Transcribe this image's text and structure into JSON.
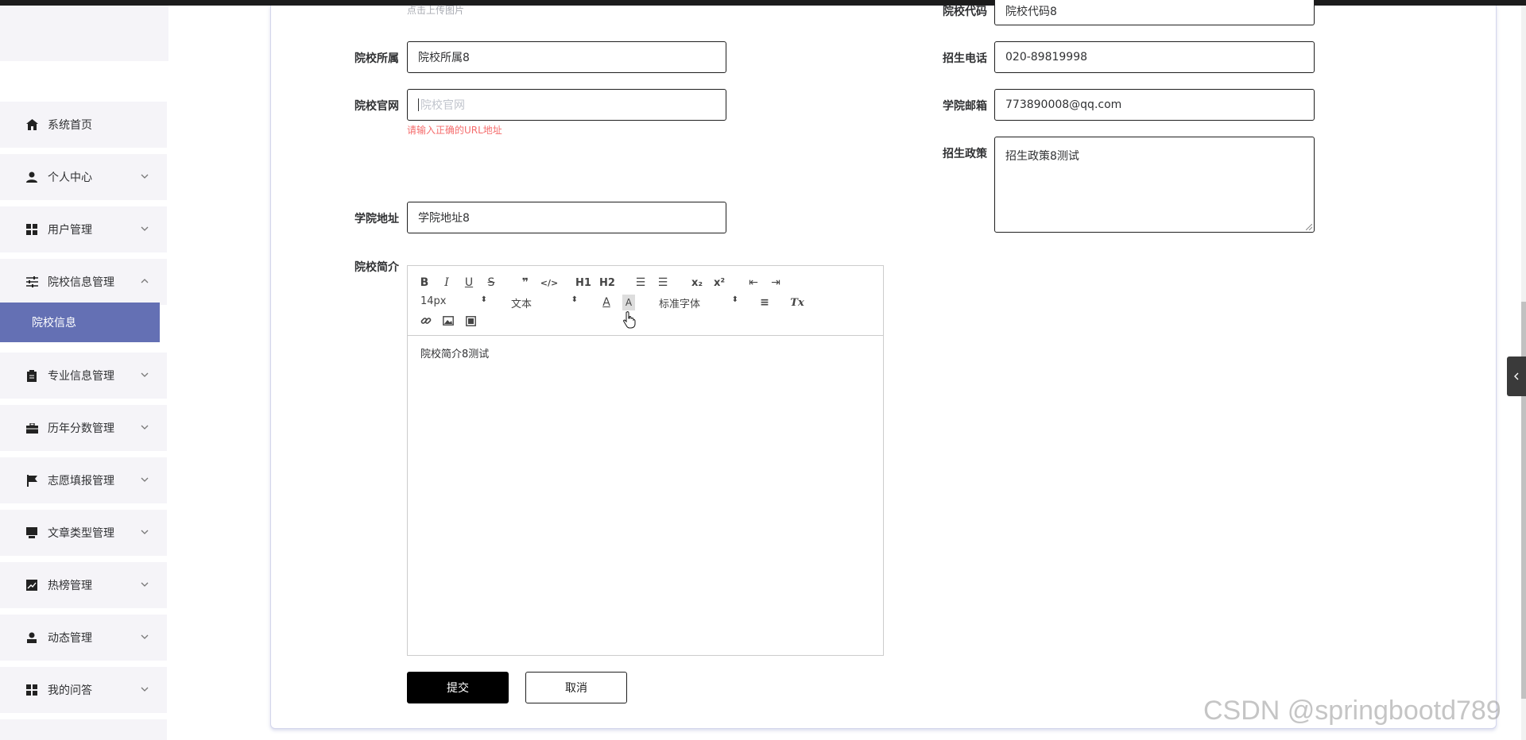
{
  "sidebar": {
    "items": [
      {
        "label": "系统首页",
        "icon": "home-icon"
      },
      {
        "label": "个人中心",
        "icon": "user-icon"
      },
      {
        "label": "用户管理",
        "icon": "grid-icon"
      },
      {
        "label": "院校信息管理",
        "icon": "sliders-icon"
      },
      {
        "label": "专业信息管理",
        "icon": "clipboard-icon"
      },
      {
        "label": "历年分数管理",
        "icon": "briefcase-icon"
      },
      {
        "label": "志愿填报管理",
        "icon": "flag-icon"
      },
      {
        "label": "文章类型管理",
        "icon": "monitor-icon"
      },
      {
        "label": "热榜管理",
        "icon": "chart-icon"
      },
      {
        "label": "动态管理",
        "icon": "person-icon"
      },
      {
        "label": "我的问答",
        "icon": "grid-icon"
      }
    ],
    "active_sub": "院校信息"
  },
  "form": {
    "upload_hint": "点击上传图片",
    "school_code": {
      "label": "院校代码",
      "value": "院校代码8"
    },
    "school_affiliation": {
      "label": "院校所属",
      "value": "院校所属8"
    },
    "admission_phone": {
      "label": "招生电话",
      "value": "020-89819998"
    },
    "school_website": {
      "label": "院校官网",
      "placeholder": "院校官网",
      "error": "请输入正确的URL地址"
    },
    "college_email": {
      "label": "学院邮箱",
      "value": "773890008@qq.com"
    },
    "admission_policy": {
      "label": "招生政策",
      "value": "招生政策8测试"
    },
    "college_address": {
      "label": "学院地址",
      "value": "学院地址8"
    },
    "school_intro": {
      "label": "院校简介",
      "value": "院校简介8测试"
    }
  },
  "editor_toolbar": {
    "bold": "B",
    "italic": "I",
    "underline": "U",
    "strike": "S",
    "quote": "❞",
    "code": "</>",
    "h1": "H1",
    "h2": "H2",
    "ordered_list": "☰",
    "bullet_list": "☰",
    "sub": "x₂",
    "sup": "x²",
    "outdent": "⇤",
    "indent": "⇥",
    "font_size": "14px",
    "text_type": "文本",
    "font_color": "A",
    "bg_color": "A",
    "font_family": "标准字体",
    "align": "≡",
    "clear_format": "Tx"
  },
  "buttons": {
    "submit": "提交",
    "cancel": "取消"
  },
  "watermark": "CSDN @springbootd789"
}
